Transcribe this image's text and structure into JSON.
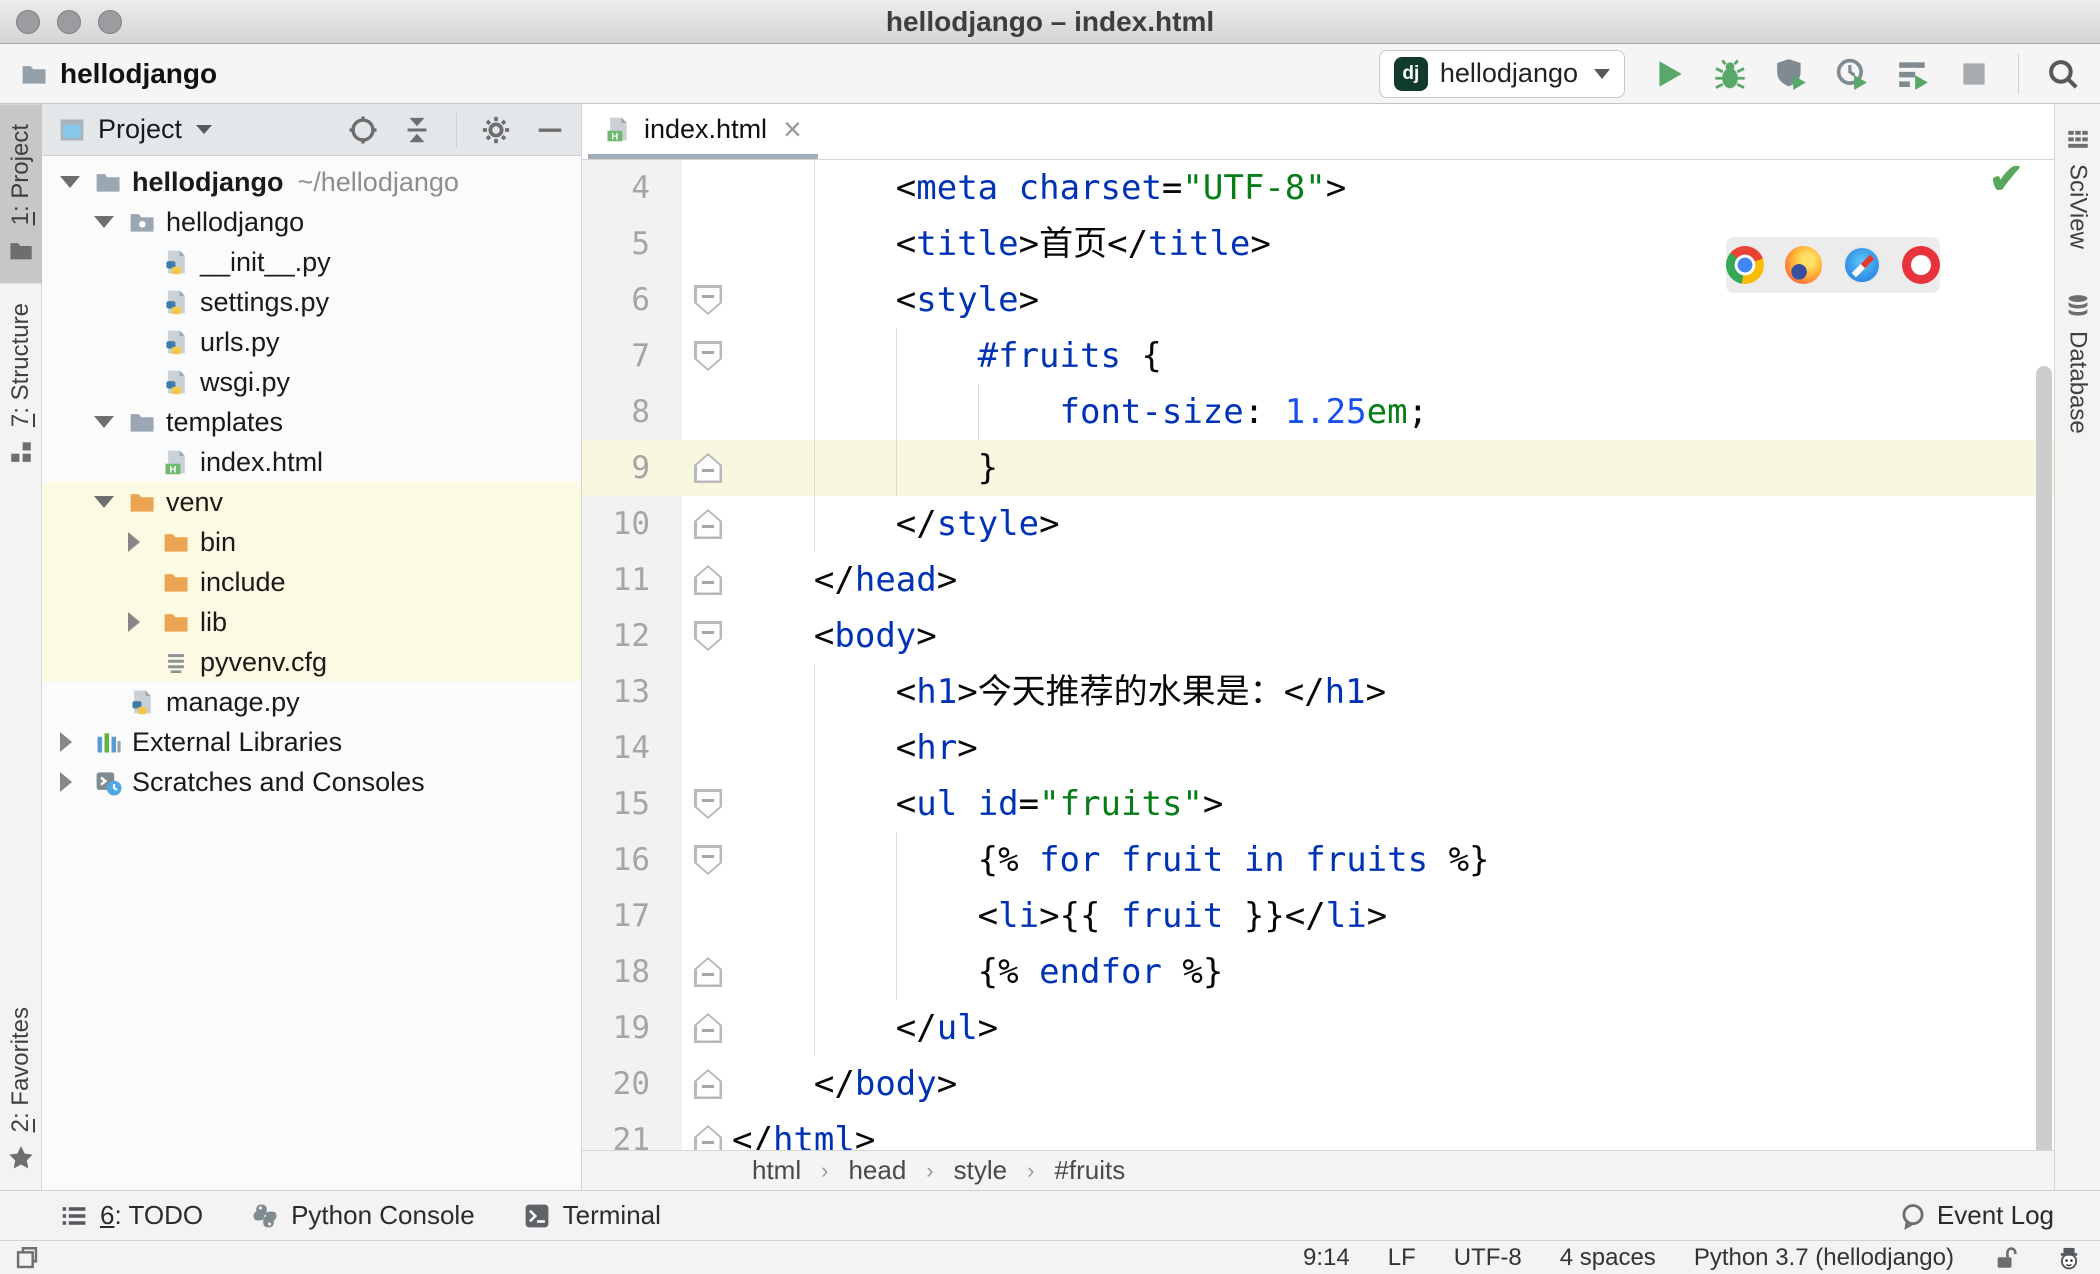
{
  "window": {
    "title": "hellodjango – index.html"
  },
  "toolbar": {
    "project_name": "hellodjango",
    "run_config": "hellodjango",
    "run_config_badge": "dj",
    "icons": [
      "run-icon",
      "debug-icon",
      "run-with-coverage-icon",
      "profiler-icon",
      "concurrency-icon",
      "stop-icon",
      "search-everywhere-icon"
    ]
  },
  "left_stripe": {
    "top": [
      {
        "label": "1: Project",
        "icon": "project-folder",
        "active": true
      },
      {
        "label": "7: Structure",
        "icon": "structure-grid",
        "active": false
      }
    ],
    "bottom": [
      {
        "label": "2: Favorites",
        "icon": "star",
        "active": false
      }
    ]
  },
  "right_stripe": [
    {
      "label": "SciView",
      "icon": "sciview-grid"
    },
    {
      "label": "Database",
      "icon": "database-stack"
    }
  ],
  "project_panel": {
    "title": "Project",
    "header_icons": [
      "locate-icon",
      "collapse-all-icon",
      "gear-icon",
      "hide-icon"
    ],
    "tree": [
      {
        "depth": 0,
        "chevron": "down",
        "icon": "folder",
        "label": "hellodjango",
        "hint": "~/hellodjango",
        "bold": true,
        "highlight": false
      },
      {
        "depth": 1,
        "chevron": "down",
        "icon": "folder-package",
        "label": "hellodjango",
        "highlight": false
      },
      {
        "depth": 2,
        "chevron": "none",
        "icon": "python-file",
        "label": "__init__.py",
        "highlight": false
      },
      {
        "depth": 2,
        "chevron": "none",
        "icon": "python-file",
        "label": "settings.py",
        "highlight": false
      },
      {
        "depth": 2,
        "chevron": "none",
        "icon": "python-file",
        "label": "urls.py",
        "highlight": false
      },
      {
        "depth": 2,
        "chevron": "none",
        "icon": "python-file",
        "label": "wsgi.py",
        "highlight": false
      },
      {
        "depth": 1,
        "chevron": "down",
        "icon": "folder",
        "label": "templates",
        "highlight": false
      },
      {
        "depth": 2,
        "chevron": "none",
        "icon": "html-file",
        "label": "index.html",
        "highlight": false
      },
      {
        "depth": 1,
        "chevron": "down",
        "icon": "folder-excluded",
        "label": "venv",
        "highlight": true
      },
      {
        "depth": 2,
        "chevron": "right",
        "icon": "folder-excluded",
        "label": "bin",
        "highlight": true
      },
      {
        "depth": 2,
        "chevron": "none",
        "icon": "folder-excluded",
        "label": "include",
        "highlight": true
      },
      {
        "depth": 2,
        "chevron": "right",
        "icon": "folder-excluded",
        "label": "lib",
        "highlight": true
      },
      {
        "depth": 2,
        "chevron": "none",
        "icon": "text-file",
        "label": "pyvenv.cfg",
        "highlight": true
      },
      {
        "depth": 1,
        "chevron": "none",
        "icon": "python-file",
        "label": "manage.py",
        "highlight": false
      },
      {
        "depth": 0,
        "chevron": "right",
        "icon": "external-libs",
        "label": "External Libraries",
        "highlight": false
      },
      {
        "depth": 0,
        "chevron": "right",
        "icon": "scratches",
        "label": "Scratches and Consoles",
        "highlight": false
      }
    ]
  },
  "editor": {
    "tab": {
      "label": "index.html",
      "icon": "html-file",
      "close": "×"
    },
    "inspection_status": "check-ok",
    "popup_browsers": [
      "chrome",
      "firefox",
      "safari",
      "opera"
    ],
    "breadcrumbs": [
      "html",
      "head",
      "style",
      "#fruits"
    ],
    "lines": [
      {
        "num": 4,
        "indent": 8,
        "fold": "none",
        "current": false,
        "guides": [
          4
        ],
        "tokens": [
          [
            "p",
            "<"
          ],
          [
            "b",
            "meta"
          ],
          [
            "x",
            " "
          ],
          [
            "b",
            "charset"
          ],
          [
            "p",
            "="
          ],
          [
            "g",
            "\"UTF-8\""
          ],
          [
            "p",
            ">"
          ]
        ]
      },
      {
        "num": 5,
        "indent": 8,
        "fold": "none",
        "current": false,
        "guides": [
          4
        ],
        "tokens": [
          [
            "p",
            "<"
          ],
          [
            "b",
            "title"
          ],
          [
            "p",
            ">"
          ],
          [
            "x",
            "首页"
          ],
          [
            "p",
            "</"
          ],
          [
            "b",
            "title"
          ],
          [
            "p",
            ">"
          ]
        ]
      },
      {
        "num": 6,
        "indent": 8,
        "fold": "start",
        "current": false,
        "guides": [
          4
        ],
        "tokens": [
          [
            "p",
            "<"
          ],
          [
            "b",
            "style"
          ],
          [
            "p",
            ">"
          ]
        ]
      },
      {
        "num": 7,
        "indent": 12,
        "fold": "start",
        "current": false,
        "guides": [
          4,
          8
        ],
        "tokens": [
          [
            "b",
            "#fruits"
          ],
          [
            "x",
            " "
          ],
          [
            "p",
            "{"
          ]
        ]
      },
      {
        "num": 8,
        "indent": 16,
        "fold": "none",
        "current": false,
        "guides": [
          4,
          8,
          12
        ],
        "tokens": [
          [
            "b",
            "font-size"
          ],
          [
            "p",
            ":"
          ],
          [
            "x",
            " "
          ],
          [
            "n",
            "1.25"
          ],
          [
            "g",
            "em"
          ],
          [
            "p",
            ";"
          ]
        ]
      },
      {
        "num": 9,
        "indent": 12,
        "fold": "end",
        "current": true,
        "guides": [
          4,
          8
        ],
        "tokens": [
          [
            "p",
            "}"
          ]
        ]
      },
      {
        "num": 10,
        "indent": 8,
        "fold": "end",
        "current": false,
        "guides": [
          4
        ],
        "tokens": [
          [
            "p",
            "</"
          ],
          [
            "b",
            "style"
          ],
          [
            "p",
            ">"
          ]
        ]
      },
      {
        "num": 11,
        "indent": 4,
        "fold": "end",
        "current": false,
        "guides": [],
        "tokens": [
          [
            "p",
            "</"
          ],
          [
            "b",
            "head"
          ],
          [
            "p",
            ">"
          ]
        ]
      },
      {
        "num": 12,
        "indent": 4,
        "fold": "start",
        "current": false,
        "guides": [],
        "tokens": [
          [
            "p",
            "<"
          ],
          [
            "b",
            "body"
          ],
          [
            "p",
            ">"
          ]
        ]
      },
      {
        "num": 13,
        "indent": 8,
        "fold": "none",
        "current": false,
        "guides": [
          4
        ],
        "tokens": [
          [
            "p",
            "<"
          ],
          [
            "b",
            "h1"
          ],
          [
            "p",
            ">"
          ],
          [
            "x",
            "今天推荐的水果是："
          ],
          [
            "p",
            "</"
          ],
          [
            "b",
            "h1"
          ],
          [
            "p",
            ">"
          ]
        ]
      },
      {
        "num": 14,
        "indent": 8,
        "fold": "none",
        "current": false,
        "guides": [
          4
        ],
        "tokens": [
          [
            "p",
            "<"
          ],
          [
            "b",
            "hr"
          ],
          [
            "p",
            ">"
          ]
        ]
      },
      {
        "num": 15,
        "indent": 8,
        "fold": "start",
        "current": false,
        "guides": [
          4
        ],
        "tokens": [
          [
            "p",
            "<"
          ],
          [
            "b",
            "ul"
          ],
          [
            "x",
            " "
          ],
          [
            "b",
            "id"
          ],
          [
            "p",
            "="
          ],
          [
            "g",
            "\"fruits\""
          ],
          [
            "p",
            ">"
          ]
        ]
      },
      {
        "num": 16,
        "indent": 12,
        "fold": "start",
        "current": false,
        "guides": [
          4,
          8
        ],
        "tokens": [
          [
            "p",
            "{%"
          ],
          [
            "x",
            " "
          ],
          [
            "b",
            "for"
          ],
          [
            "x",
            " "
          ],
          [
            "v",
            "fruit"
          ],
          [
            "x",
            " "
          ],
          [
            "b",
            "in"
          ],
          [
            "x",
            " "
          ],
          [
            "v",
            "fruits"
          ],
          [
            "x",
            " "
          ],
          [
            "p",
            "%}"
          ]
        ]
      },
      {
        "num": 17,
        "indent": 12,
        "fold": "none",
        "current": false,
        "guides": [
          4,
          8
        ],
        "tokens": [
          [
            "p",
            "<"
          ],
          [
            "b",
            "li"
          ],
          [
            "p",
            ">"
          ],
          [
            "p",
            "{{"
          ],
          [
            "x",
            " "
          ],
          [
            "v",
            "fruit"
          ],
          [
            "x",
            " "
          ],
          [
            "p",
            "}}"
          ],
          [
            "p",
            "</"
          ],
          [
            "b",
            "li"
          ],
          [
            "p",
            ">"
          ]
        ]
      },
      {
        "num": 18,
        "indent": 12,
        "fold": "end",
        "current": false,
        "guides": [
          4,
          8
        ],
        "tokens": [
          [
            "p",
            "{%"
          ],
          [
            "x",
            " "
          ],
          [
            "b",
            "endfor"
          ],
          [
            "x",
            " "
          ],
          [
            "p",
            "%}"
          ]
        ]
      },
      {
        "num": 19,
        "indent": 8,
        "fold": "end",
        "current": false,
        "guides": [
          4
        ],
        "tokens": [
          [
            "p",
            "</"
          ],
          [
            "b",
            "ul"
          ],
          [
            "p",
            ">"
          ]
        ]
      },
      {
        "num": 20,
        "indent": 4,
        "fold": "end",
        "current": false,
        "guides": [],
        "tokens": [
          [
            "p",
            "</"
          ],
          [
            "b",
            "body"
          ],
          [
            "p",
            ">"
          ]
        ]
      },
      {
        "num": 21,
        "indent": 0,
        "fold": "end",
        "current": false,
        "guides": [],
        "tokens": [
          [
            "p",
            "</"
          ],
          [
            "b",
            "html"
          ],
          [
            "p",
            ">"
          ]
        ]
      }
    ]
  },
  "bottom_bar": {
    "items": [
      {
        "label": "6: TODO",
        "icon": "todo-list"
      },
      {
        "label": "Python Console",
        "icon": "python"
      },
      {
        "label": "Terminal",
        "icon": "terminal"
      }
    ],
    "event_log": "Event Log"
  },
  "status_bar": {
    "items": [
      "9:14",
      "LF",
      "UTF-8",
      "4 spaces",
      "Python 3.7 (hellodjango)"
    ],
    "icons": [
      "unlock-icon",
      "hector-icon",
      "toolwindows-icon"
    ]
  },
  "colors": {
    "tag_blue": "#0033B3",
    "string_green": "#067D17",
    "number_blue": "#1750EB",
    "run_green": "#59A869",
    "excluded_folder_orange": "#ECA352",
    "tree_highlight_yellow": "#FCFAE2",
    "caret_line_yellow": "#FAF7E1"
  }
}
